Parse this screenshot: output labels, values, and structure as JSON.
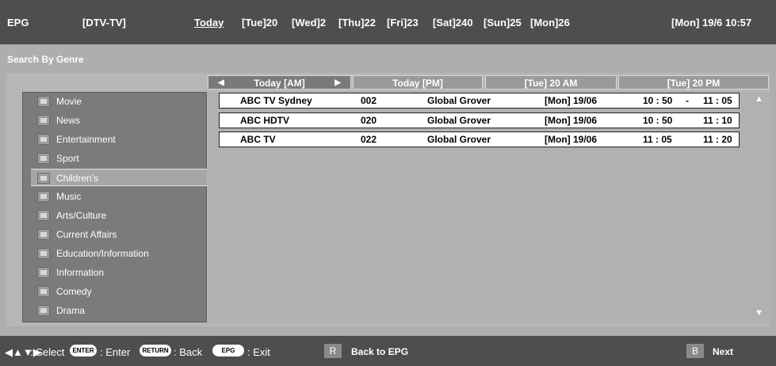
{
  "header": {
    "app_label": "EPG",
    "source": "[DTV-TV]",
    "days": [
      "Today",
      "[Tue]20",
      "[Wed]2",
      "[Thu]22",
      "[Fri]23",
      "[Sat]240",
      "[Sun]25",
      "[Mon]26"
    ],
    "datetime": "[Mon] 19/6 10:57"
  },
  "page_title": "Search By Genre",
  "tabs": [
    {
      "label": "Today [AM]"
    },
    {
      "label": "Today [PM]"
    },
    {
      "label": "[Tue] 20 AM"
    },
    {
      "label": "[Tue] 20 PM"
    }
  ],
  "genres": [
    {
      "label": "Movie",
      "icon": "movie-icon"
    },
    {
      "label": "News",
      "icon": "news-icon"
    },
    {
      "label": "Entertainment",
      "icon": "entertainment-icon"
    },
    {
      "label": "Sport",
      "icon": "sport-icon"
    },
    {
      "label": "Children's",
      "icon": "children-icon"
    },
    {
      "label": "Music",
      "icon": "music-icon"
    },
    {
      "label": "Arts/Culture",
      "icon": "arts-icon"
    },
    {
      "label": "Current Affairs",
      "icon": "current-affairs-icon"
    },
    {
      "label": "Education/Information",
      "icon": "education-icon"
    },
    {
      "label": "Information",
      "icon": "information-icon"
    },
    {
      "label": "Comedy",
      "icon": "comedy-icon"
    },
    {
      "label": "Drama",
      "icon": "drama-icon"
    }
  ],
  "selected_genre": "Children's",
  "results": [
    {
      "channel": "ABC TV Sydney",
      "number": "002",
      "program": "Global Grover",
      "date": "[Mon] 19/06",
      "start": "10 : 50",
      "sep": "-",
      "end": "11 : 05"
    },
    {
      "channel": "ABC HDTV",
      "number": "020",
      "program": "Global Grover",
      "date": "[Mon] 19/06",
      "start": "10 : 50",
      "sep": "",
      "end": "11 : 10"
    },
    {
      "channel": "ABC TV",
      "number": "022",
      "program": "Global Grover",
      "date": "[Mon] 19/06",
      "start": "11 : 05",
      "sep": "",
      "end": "11 : 20"
    }
  ],
  "footer": {
    "select_label": ": Select",
    "enter_key": "ENTER",
    "enter_label": ": Enter",
    "return_key": "RETURN",
    "back_label": ": Back",
    "epg_key": "EPG",
    "exit_label": ": Exit",
    "r_key": "R",
    "back_to_epg": "Back to EPG",
    "b_key": "B",
    "next": "Next"
  }
}
